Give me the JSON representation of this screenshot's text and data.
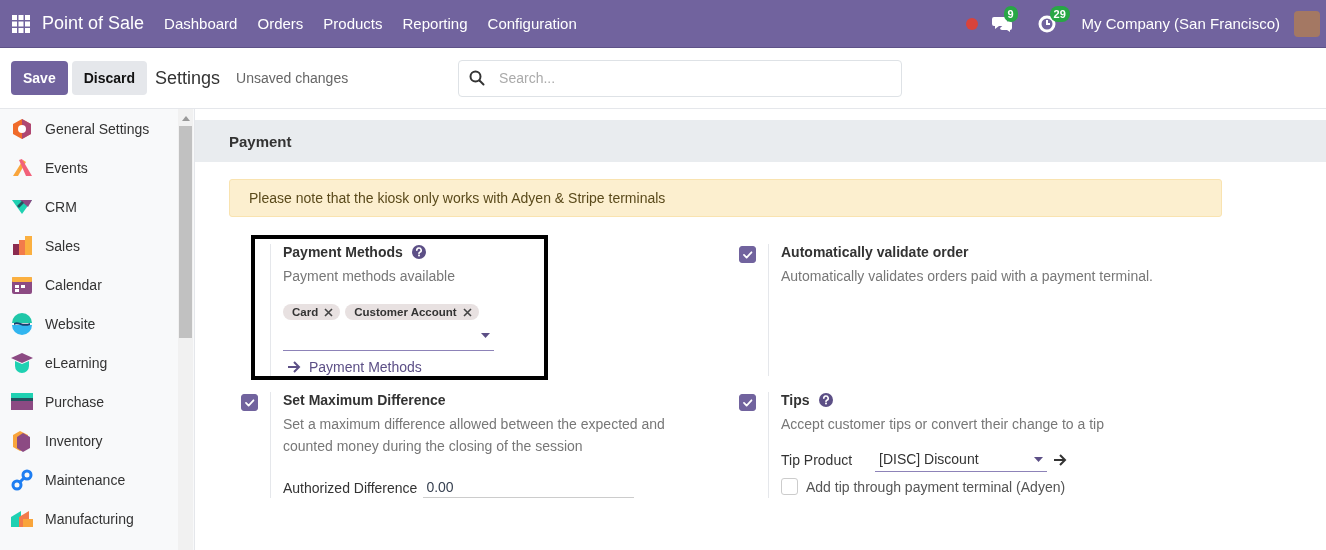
{
  "navbar": {
    "app_name": "Point of Sale",
    "menu": [
      "Dashboard",
      "Orders",
      "Products",
      "Reporting",
      "Configuration"
    ],
    "messages_count": "9",
    "activities_count": "29",
    "company": "My Company (San Francisco)"
  },
  "control_panel": {
    "save": "Save",
    "discard": "Discard",
    "breadcrumb": "Settings",
    "status": "Unsaved changes",
    "search": {
      "placeholder": "Search..."
    }
  },
  "sidebar": {
    "items": [
      {
        "label": "General Settings",
        "selected": false
      },
      {
        "label": "Events",
        "selected": false
      },
      {
        "label": "CRM",
        "selected": false
      },
      {
        "label": "Sales",
        "selected": false
      },
      {
        "label": "Calendar",
        "selected": false
      },
      {
        "label": "Website",
        "selected": false
      },
      {
        "label": "eLearning",
        "selected": false
      },
      {
        "label": "Purchase",
        "selected": false
      },
      {
        "label": "Inventory",
        "selected": false
      },
      {
        "label": "Maintenance",
        "selected": false
      },
      {
        "label": "Manufacturing",
        "selected": false
      }
    ]
  },
  "section": {
    "title": "Payment",
    "alert": "Please note that the kiosk only works with Adyen & Stripe terminals",
    "settings": [
      {
        "kind": "tags",
        "title": "Payment Methods",
        "help": true,
        "highlighted": true,
        "description": "Payment methods available",
        "tags": [
          "Card",
          "Customer Account"
        ],
        "link": "Payment Methods"
      },
      {
        "kind": "checkbox",
        "title": "Automatically validate order",
        "checked": true,
        "description": "Automatically validates orders paid with a payment terminal."
      },
      {
        "kind": "checkbox",
        "title": "Set Maximum Difference",
        "checked": true,
        "description": "Set a maximum difference allowed between the expected and counted money during the closing of the session",
        "field": {
          "kind": "input",
          "label": "Authorized Difference",
          "value": "0.00"
        }
      },
      {
        "kind": "checkbox",
        "title": "Tips",
        "checked": true,
        "help": true,
        "description": "Accept customer tips or convert their change to a tip",
        "field": {
          "kind": "select",
          "label": "Tip Product",
          "value": "[DISC] Discount"
        },
        "option": {
          "label": "Add tip through payment terminal (Adyen)",
          "checked": false
        }
      }
    ]
  }
}
